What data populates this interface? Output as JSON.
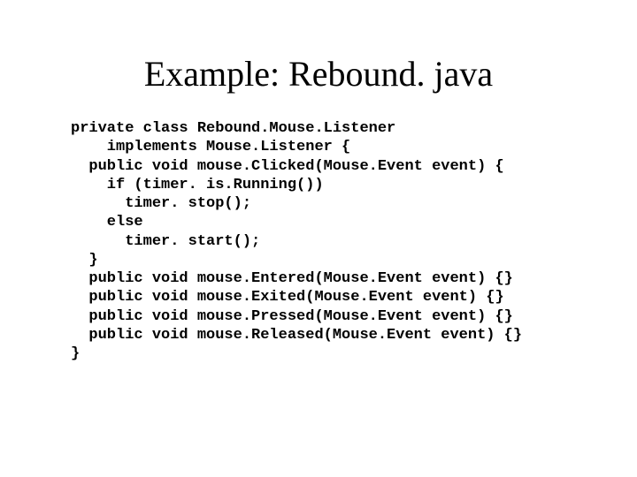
{
  "title": "Example: Rebound. java",
  "code": {
    "l1": "private class Rebound.Mouse.Listener",
    "l2": "    implements Mouse.Listener {",
    "l3": "  public void mouse.Clicked(Mouse.Event event) {",
    "l4": "    if (timer. is.Running())",
    "l5": "      timer. stop();",
    "l6": "    else",
    "l7": "      timer. start();",
    "l8": "  }",
    "l9": "  public void mouse.Entered(Mouse.Event event) {}",
    "l10": "  public void mouse.Exited(Mouse.Event event) {}",
    "l11": "  public void mouse.Pressed(Mouse.Event event) {}",
    "l12": "  public void mouse.Released(Mouse.Event event) {}",
    "l13": "}"
  }
}
